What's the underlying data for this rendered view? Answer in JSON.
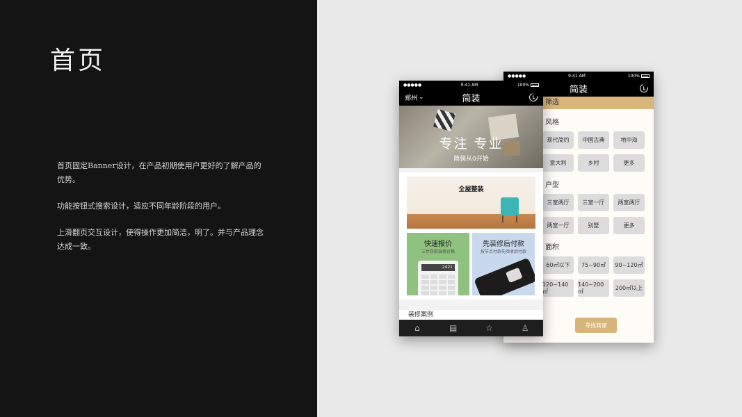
{
  "slide": {
    "title": "首页",
    "paragraphs": [
      "首页固定Banner设计，在产品初期使用户更好的了解产品的优势。",
      "功能按钮式搜索设计，适应不同年龄阶段的用户。",
      "上滑翻页交互设计，使得操作更加简洁，明了。并与产品理念达成一致。"
    ]
  },
  "status": {
    "signal": "●●●●● ",
    "time": "9:41 AM",
    "battery": "100%"
  },
  "front": {
    "city": "郑州",
    "title": "简装",
    "banner": {
      "title": "专注 专业",
      "subtitle": "简装从0开始"
    },
    "whole_house": "全屋整装",
    "quote": {
      "title": "快速报价",
      "subtitle": "三步获取装修价格"
    },
    "install": {
      "title": "先装修后付款",
      "subtitle": "按节点付款先验收后付款"
    },
    "calc_display": "2421",
    "cases_label": "装修案例",
    "tabs": [
      "home-icon",
      "book-icon",
      "star-icon",
      "user-icon"
    ]
  },
  "back": {
    "title": "简装",
    "filter_label": "筛选",
    "style_label": "风格",
    "style_row1": [
      "现代简约",
      "中国古典",
      "地中海"
    ],
    "style_row2": [
      "意大利",
      "乡村",
      "更多"
    ],
    "layout_label": "户型",
    "layout_row1": [
      "三室两厅",
      "三室一厅",
      "两室两厅"
    ],
    "layout_row2": [
      "两室一厅",
      "别墅",
      "更多"
    ],
    "area_label": "面积",
    "area_row1": [
      "60㎡以下",
      "75~90㎡",
      "90~120㎡"
    ],
    "area_row2": [
      "120~140㎡",
      "140~200㎡",
      "200㎡以上"
    ],
    "find_button": "寻找商家"
  },
  "colors": {
    "gold": "#d8b57a",
    "dark": "#141414",
    "green": "#8fc17f",
    "blue": "#c8d9ee"
  }
}
